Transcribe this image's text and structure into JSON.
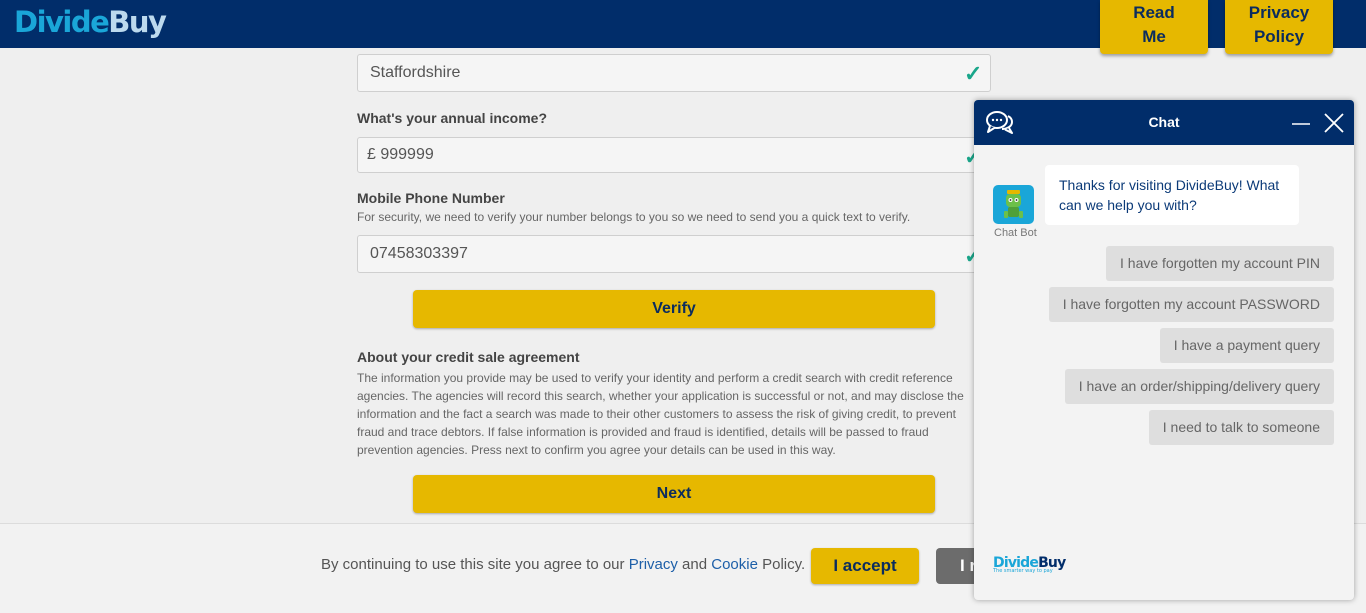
{
  "header": {
    "logo_part1": "Divide",
    "logo_part2": "Buy",
    "read_me_line1": "Read",
    "read_me_line2": "Me",
    "privacy_line1": "Privacy",
    "privacy_line2": "Policy"
  },
  "form": {
    "county_value": "Staffordshire",
    "income_label": "What's your annual income?",
    "income_currency": "£",
    "income_value": "999999",
    "phone_label": "Mobile Phone Number",
    "phone_note": "For security, we need to verify your number belongs to you so we need to send you a quick text to verify.",
    "phone_value": "07458303397",
    "verify_label": "Verify",
    "credit_heading": "About your credit sale agreement",
    "credit_text": "The information you provide may be used to verify your identity and perform a credit search with credit reference agencies. The agencies will record this search, whether your application is successful or not, and may disclose the information and the fact a search was made to their other customers to assess the risk of giving credit, to prevent fraud and trace debtors. If false information is provided and fraud is identified, details will be passed to fraud prevention agencies. Press next to confirm you agree your details can be used in this way.",
    "next_label": "Next",
    "check_glyph": "✓"
  },
  "cookie": {
    "text_before": "By continuing to use this site you agree to our",
    "privacy_link": "Privacy",
    "and": "and",
    "cookie_link": "Cookie",
    "policy": "Policy.",
    "accept_label": "I accept",
    "reject_label": "I r"
  },
  "chat": {
    "title": "Chat",
    "bot_name": "Chat Bot",
    "greeting": "Thanks for visiting DivideBuy! What can we help you with?",
    "options": [
      "I have forgotten my account PIN",
      "I have forgotten my account PASSWORD",
      "I have a payment query",
      "I have an order/shipping/delivery query",
      "I need to talk to someone"
    ],
    "logo_part1": "Divide",
    "logo_part2": "Buy",
    "logo_tagline": "The smarter way to pay"
  },
  "colors": {
    "navy": "#012d6a",
    "yellow": "#e6b800",
    "check_green": "#1aa68a",
    "logo_blue": "#1aa6d8"
  },
  "icons": [
    "chat-bubbles-icon",
    "minimize-icon",
    "close-icon",
    "check-icon",
    "bot-avatar"
  ]
}
